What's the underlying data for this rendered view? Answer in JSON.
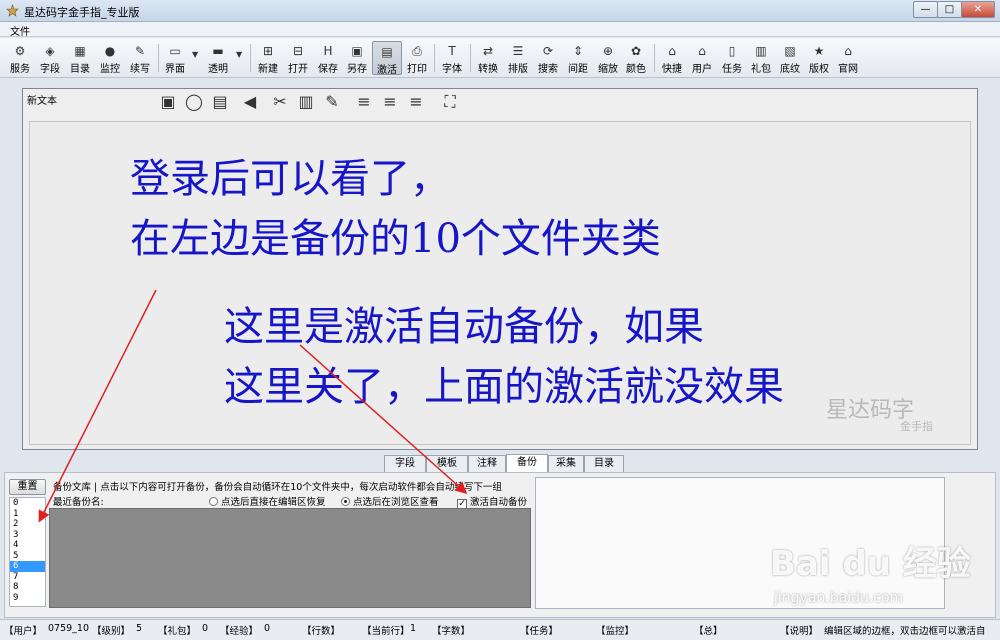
{
  "window": {
    "title": "星达码字金手指_专业版",
    "min": "—",
    "max": "□",
    "close": "✕"
  },
  "menu": {
    "file": "文件"
  },
  "toolbar": {
    "groups": [
      {
        "label": "服务",
        "icon": "service-icon"
      },
      {
        "label": "字段",
        "icon": "field-icon"
      },
      {
        "label": "目录",
        "icon": "catalog-icon"
      },
      {
        "label": "监控",
        "icon": "monitor-icon"
      },
      {
        "label": "续写",
        "icon": "continue-icon"
      },
      {
        "label": "界面",
        "icon": "interface-icon"
      },
      {
        "label": "透明",
        "icon": "transparent-icon"
      },
      {
        "label": "新建",
        "icon": "new-icon"
      },
      {
        "label": "打开",
        "icon": "open-icon"
      },
      {
        "label": "保存",
        "icon": "save-icon"
      },
      {
        "label": "另存",
        "icon": "save-as-icon"
      },
      {
        "label": "激活",
        "icon": "activate-icon"
      },
      {
        "label": "打印",
        "icon": "print-icon"
      },
      {
        "label": "字体",
        "icon": "font-icon"
      },
      {
        "label": "转换",
        "icon": "convert-icon"
      },
      {
        "label": "排版",
        "icon": "layout-icon"
      },
      {
        "label": "搜索",
        "icon": "search-icon"
      },
      {
        "label": "间距",
        "icon": "spacing-icon"
      },
      {
        "label": "缩放",
        "icon": "zoom-icon"
      },
      {
        "label": "颜色",
        "icon": "color-icon"
      },
      {
        "label": "快捷",
        "icon": "shortcut-icon"
      },
      {
        "label": "用户",
        "icon": "user-icon"
      },
      {
        "label": "任务",
        "icon": "task-icon"
      },
      {
        "label": "礼包",
        "icon": "gift-icon"
      },
      {
        "label": "底纹",
        "icon": "shading-icon"
      },
      {
        "label": "版权",
        "icon": "copyright-icon"
      },
      {
        "label": "官网",
        "icon": "website-icon"
      }
    ]
  },
  "editor": {
    "doc_tab": "新文本",
    "lines": [
      "登录后可以看了，",
      "在左边是备份的10个文件夹类",
      "这里是激活自动备份，如果",
      "这里关了，上面的激活就没效果"
    ],
    "watermark": "星达码字",
    "watermark_sub": "金手指"
  },
  "bottom_tabs": [
    "字段",
    "模板",
    "注释",
    "备份",
    "采集",
    "目录"
  ],
  "backup": {
    "reset_label": "重置",
    "folders": [
      "0",
      "1",
      "2",
      "3",
      "4",
      "5",
      "6",
      "7",
      "8",
      "9"
    ],
    "selected_folder": "6",
    "info": "备份文库 | 点击以下内容可打开备份，备份会自动循环在10个文件夹中，每次启动软件都会自动续写下一组",
    "recent_label": "最近备份名:",
    "option_restore": "点选后直接在编辑区恢复",
    "option_preview": "点选后在浏览区查看",
    "option_selected": "option_preview",
    "auto_backup_label": "激活自动备份",
    "auto_backup_checked": true
  },
  "status": {
    "user_label": "【用户】",
    "user_value": "0759_10",
    "level_label": "【级别】",
    "level_value": "5",
    "gift_label": "【礼包】",
    "gift_value": "0",
    "exp_label": "【经验】",
    "exp_value": "0",
    "lines_label": "【行数】",
    "current_label": "【当前行】",
    "current_value": "1",
    "chars_label": "【字数】",
    "task_label": "【任务】",
    "monitor_label": "【监控】",
    "total_label": "【总】",
    "note_label": "【说明】",
    "note_value": "编辑区域的边框，双击边框可以激活自"
  },
  "overlay": {
    "baidu": "Bai du 经验",
    "baidu_sub": "jingyan.baidu.com"
  }
}
